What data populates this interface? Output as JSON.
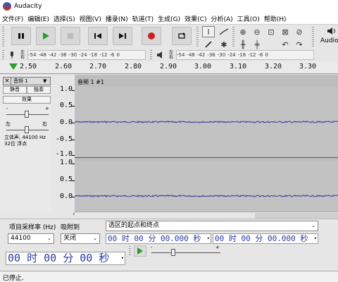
{
  "window": {
    "title": "Audacity"
  },
  "menu": [
    "文件(F)",
    "编辑(E)",
    "选择(S)",
    "视图(V)",
    "播录(N)",
    "轨道(T)",
    "生成(G)",
    "效果(C)",
    "分析(A)",
    "工具(O)",
    "帮助(H)"
  ],
  "transport": {
    "audio_label": "Audio"
  },
  "meters": {
    "rec_lr": [
      "左",
      "右"
    ],
    "play_lr": [
      "左",
      "右"
    ],
    "scale": [
      "-54",
      "-48",
      "-42",
      "-36",
      "-30",
      "-24",
      "-18",
      "-12",
      "-6",
      "0"
    ]
  },
  "ruler": {
    "ticks": [
      "2.50",
      "2.60",
      "2.70",
      "2.80",
      "2.90",
      "3.00",
      "3.10",
      "3.20",
      "3.30"
    ]
  },
  "track": {
    "name": "音频 1",
    "mute": "静音",
    "solo": "独奏",
    "effects": "效果",
    "left": "左",
    "right": "右",
    "info1": "立体声, 44100 Hz",
    "info2": "32位 浮点",
    "clip_name": "音频 1 #1",
    "axis_ch1": [
      "1.0",
      "0.5",
      "0.0",
      "-0.5",
      "-1.0"
    ],
    "axis_ch2": [
      "1.0",
      "0.5",
      "0.0"
    ]
  },
  "selection": {
    "rate_label": "项目采样率 (Hz)",
    "snap_label": "吸附到",
    "rate_value": "44100",
    "snap_value": "关闭",
    "sel_mode": "选区的起点和终点",
    "start": "00 时 00 分 00.000 秒",
    "end": "00 时 00 分 00.000 秒",
    "position": "00 时 00 分 00 秒"
  },
  "status": {
    "text": "已停止."
  },
  "colors": {
    "wave": "#3240a0",
    "play_green": "#2a9d2a",
    "record_red": "#cc1f1f"
  }
}
